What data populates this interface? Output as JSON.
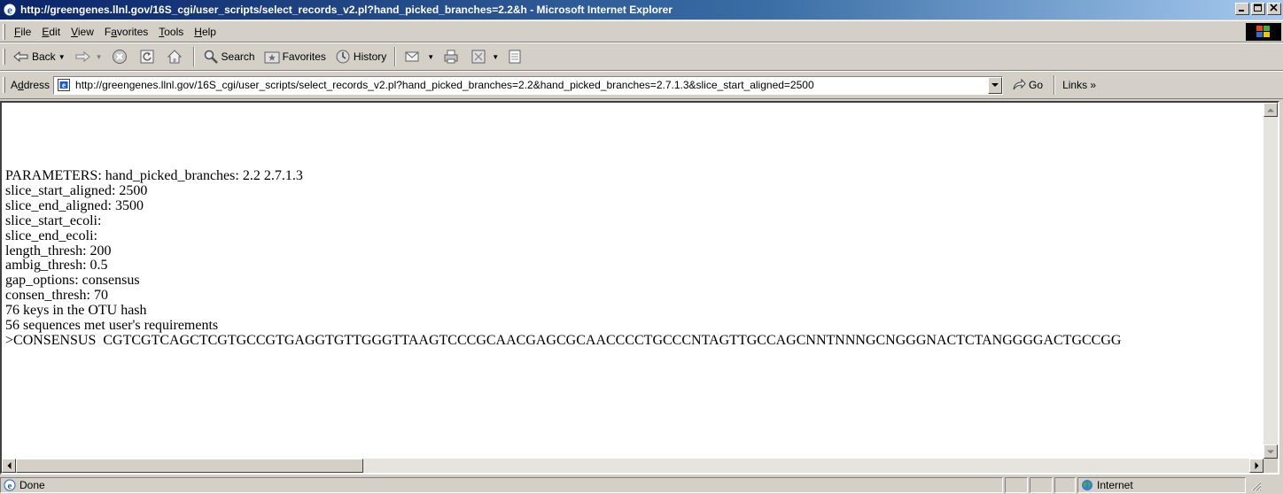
{
  "window": {
    "title": "http://greengenes.llnl.gov/16S_cgi/user_scripts/select_records_v2.pl?hand_picked_branches=2.2&h - Microsoft Internet Explorer",
    "controls": [
      "minimize",
      "maximize",
      "close"
    ]
  },
  "menu": [
    {
      "label": "File",
      "accel": "F",
      "rest": "ile"
    },
    {
      "label": "Edit",
      "accel": "E",
      "rest": "dit"
    },
    {
      "label": "View",
      "accel": "V",
      "rest": "iew"
    },
    {
      "label": "Favorites",
      "pre": "F",
      "accel": "a",
      "rest": "vorites"
    },
    {
      "label": "Tools",
      "accel": "T",
      "rest": "ools"
    },
    {
      "label": "Help",
      "accel": "H",
      "rest": "elp"
    }
  ],
  "toolbar": {
    "back": "Back",
    "search": "Search",
    "favorites": "Favorites",
    "history": "History"
  },
  "address": {
    "label_pre": "A",
    "label_accel": "d",
    "label_rest": "dress",
    "url": "http://greengenes.llnl.gov/16S_cgi/user_scripts/select_records_v2.pl?hand_picked_branches=2.2&hand_picked_branches=2.7.1.3&slice_start_aligned=2500",
    "go": "Go",
    "links": "Links »"
  },
  "content": {
    "lines": [
      "PARAMETERS: hand_picked_branches: 2.2 2.7.1.3",
      "slice_start_aligned: 2500",
      "slice_end_aligned: 3500",
      "slice_start_ecoli:",
      "slice_end_ecoli:",
      "length_thresh: 200",
      "ambig_thresh: 0.5",
      "gap_options: consensus",
      "consen_thresh: 70",
      "76 keys in the OTU hash",
      "56 sequences met user's requirements",
      ">CONSENSUS  CGTCGTCAGCTCGTGCCGTGAGGTGTTGGGTTAAGTCCCGCAACGAGCGCAACCCCTGCCCNTAGTTGCCAGCNNTNNNGCNGGGNACTCTANGGGGACTGCCGG"
    ]
  },
  "status": {
    "text": "Done",
    "zone": "Internet"
  },
  "colors": {
    "title_start": "#0a246a",
    "title_end": "#a6caf0",
    "chrome": "#d4d0c8"
  }
}
